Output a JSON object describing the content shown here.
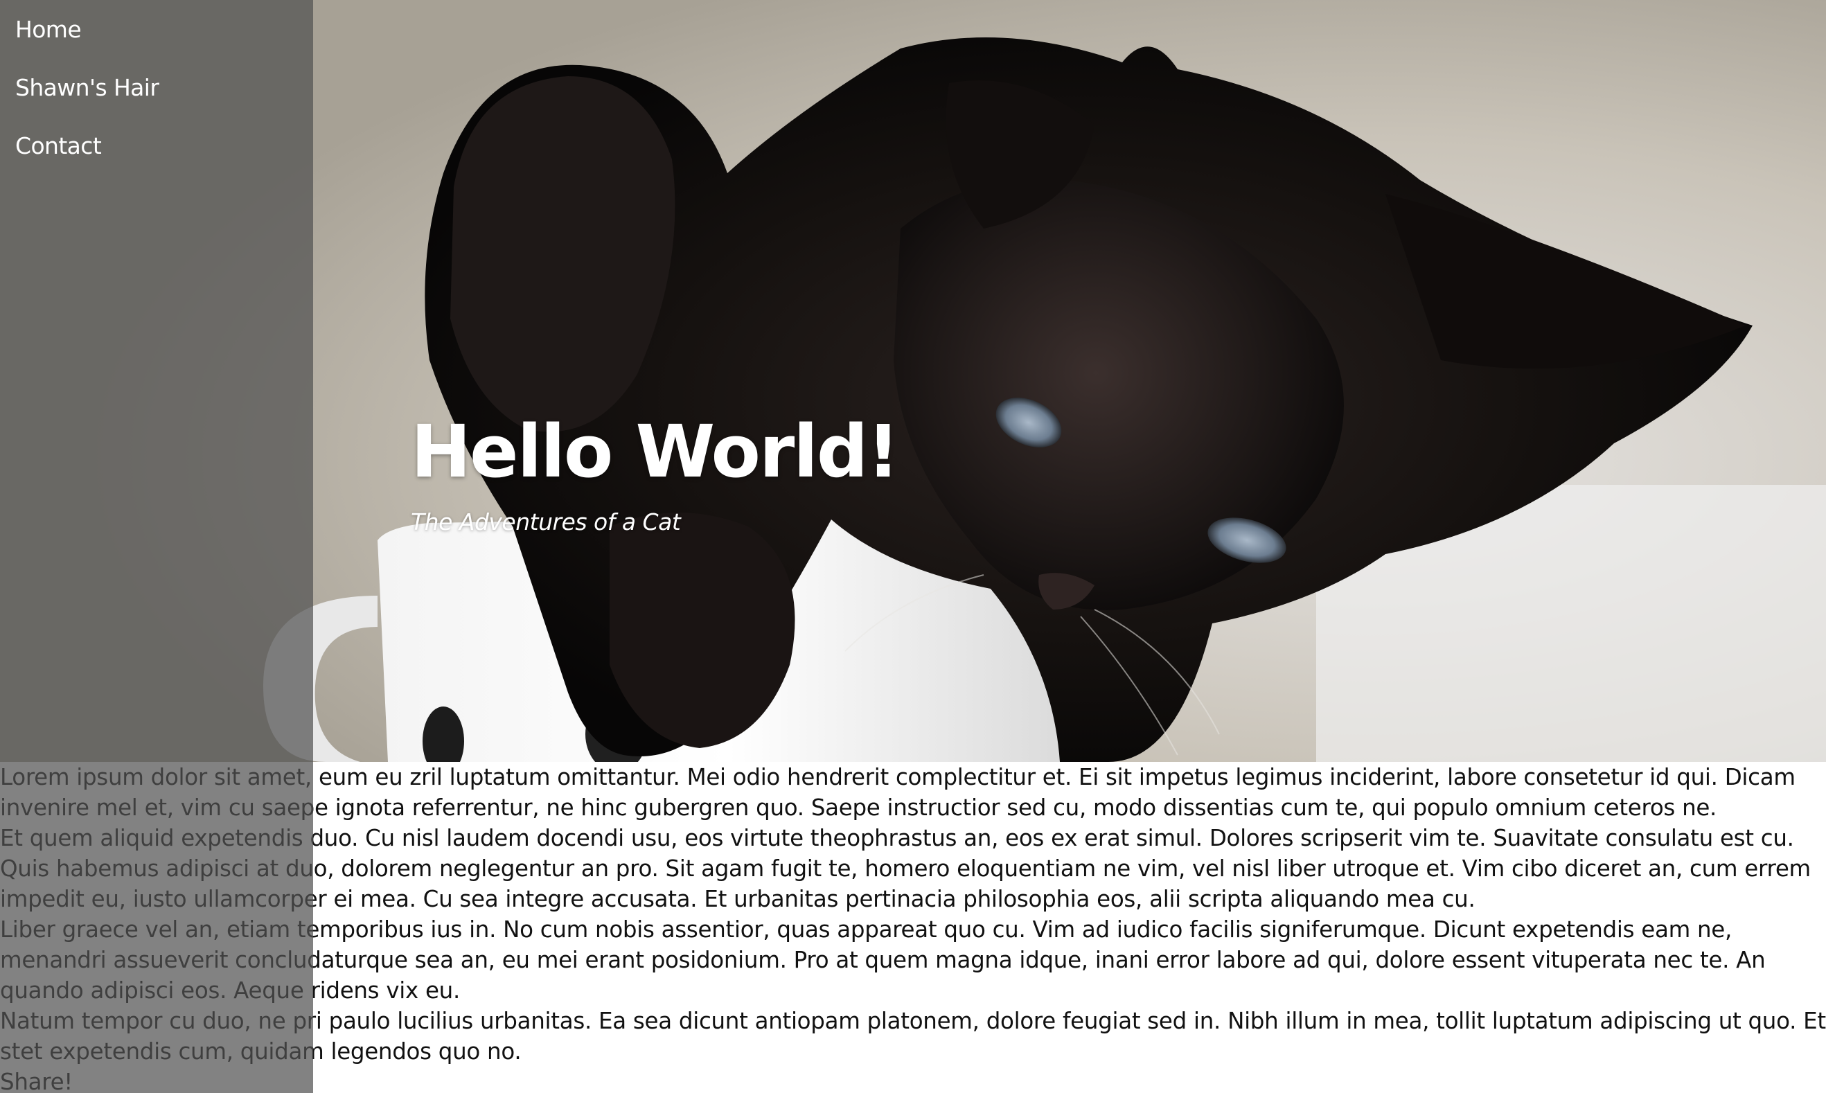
{
  "nav": {
    "items": [
      {
        "label": "Home"
      },
      {
        "label": "Shawn's Hair"
      },
      {
        "label": "Contact"
      }
    ]
  },
  "hero": {
    "title": "Hello World!",
    "subtitle": "The Adventures of a Cat"
  },
  "content": {
    "paragraphs": [
      "Lorem ipsum dolor sit amet, eum eu zril luptatum omittantur. Mei odio hendrerit complectitur et. Ei sit impetus legimus inciderint, labore consetetur id qui. Dicam invenire mel et, vim cu saepe ignota referrentur, ne hinc gubergren quo. Saepe instructior sed cu, modo dissentias cum te, qui populo omnium ceteros ne.",
      "Et quem aliquid expetendis duo. Cu nisl laudem docendi usu, eos virtute theophrastus an, eos ex erat simul. Dolores scripserit vim te. Suavitate consulatu est cu.",
      "Quis habemus adipisci at duo, dolorem neglegentur an pro. Sit agam fugit te, homero eloquentiam ne vim, vel nisl liber utroque et. Vim cibo diceret an, cum errem impedit eu, iusto ullamcorper ei mea. Cu sea integre accusata. Et urbanitas pertinacia philosophia eos, alii scripta aliquando mea cu.",
      "Liber graece vel an, etiam temporibus ius in. No cum nobis assentior, quas appareat quo cu. Vim ad iudico facilis signiferumque. Dicunt expetendis eam ne, menandri assueverit concludaturque sea an, eu mei erant posidonium. Pro at quem magna idque, inani error labore ad qui, dolore essent vituperata nec te. An quando adipisci eos. Aeque ridens vix eu.",
      "Natum tempor cu duo, ne pri paulo lucilius urbanitas. Ea sea dicunt antiopam platonem, dolore feugiat sed in. Nibh illum in mea, tollit luptatum adipiscing ut quo. Et stet expetendis cum, quidam legendos quo no."
    ],
    "share_label": "Share!"
  }
}
